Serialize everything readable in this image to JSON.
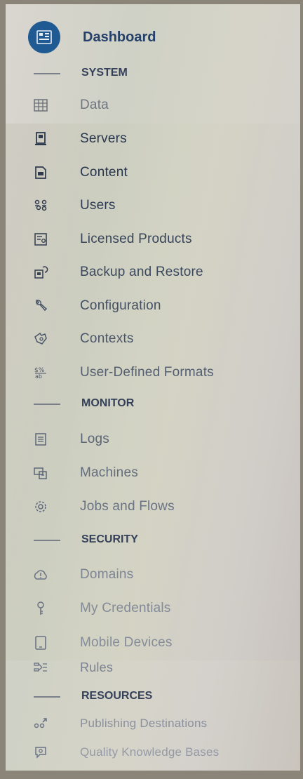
{
  "nav": {
    "dashboard": "Dashboard",
    "sections": {
      "system": "SYSTEM",
      "monitor": "MONITOR",
      "security": "SECURITY",
      "resources": "RESOURCES"
    },
    "items": [
      {
        "id": "data",
        "label": "Data",
        "icon": "table-icon"
      },
      {
        "id": "servers",
        "label": "Servers",
        "icon": "server-icon"
      },
      {
        "id": "content",
        "label": "Content",
        "icon": "content-icon"
      },
      {
        "id": "users",
        "label": "Users",
        "icon": "users-icon"
      },
      {
        "id": "licensed",
        "label": "Licensed Products",
        "icon": "license-icon"
      },
      {
        "id": "backup",
        "label": "Backup and Restore",
        "icon": "backup-icon"
      },
      {
        "id": "configuration",
        "label": "Configuration",
        "icon": "wrench-icon"
      },
      {
        "id": "contexts",
        "label": "Contexts",
        "icon": "contexts-icon"
      },
      {
        "id": "formats",
        "label": "User-Defined Formats",
        "icon": "formats-icon"
      },
      {
        "id": "logs",
        "label": "Logs",
        "icon": "logs-icon"
      },
      {
        "id": "machines",
        "label": "Machines",
        "icon": "machines-icon"
      },
      {
        "id": "jobs",
        "label": "Jobs and Flows",
        "icon": "gear-icon"
      },
      {
        "id": "domains",
        "label": "Domains",
        "icon": "domain-icon"
      },
      {
        "id": "credentials",
        "label": "My Credentials",
        "icon": "key-icon"
      },
      {
        "id": "mobile",
        "label": "Mobile Devices",
        "icon": "tablet-icon"
      },
      {
        "id": "rules",
        "label": "Rules",
        "icon": "rules-icon"
      },
      {
        "id": "publishing",
        "label": "Publishing Destinations",
        "icon": "publishing-icon"
      },
      {
        "id": "quality",
        "label": "Quality Knowledge Bases",
        "icon": "knowledge-icon"
      }
    ]
  },
  "colors": {
    "accent": "#1f5a93",
    "text_dark": "#2c3a52",
    "icon": "#4a5568"
  }
}
